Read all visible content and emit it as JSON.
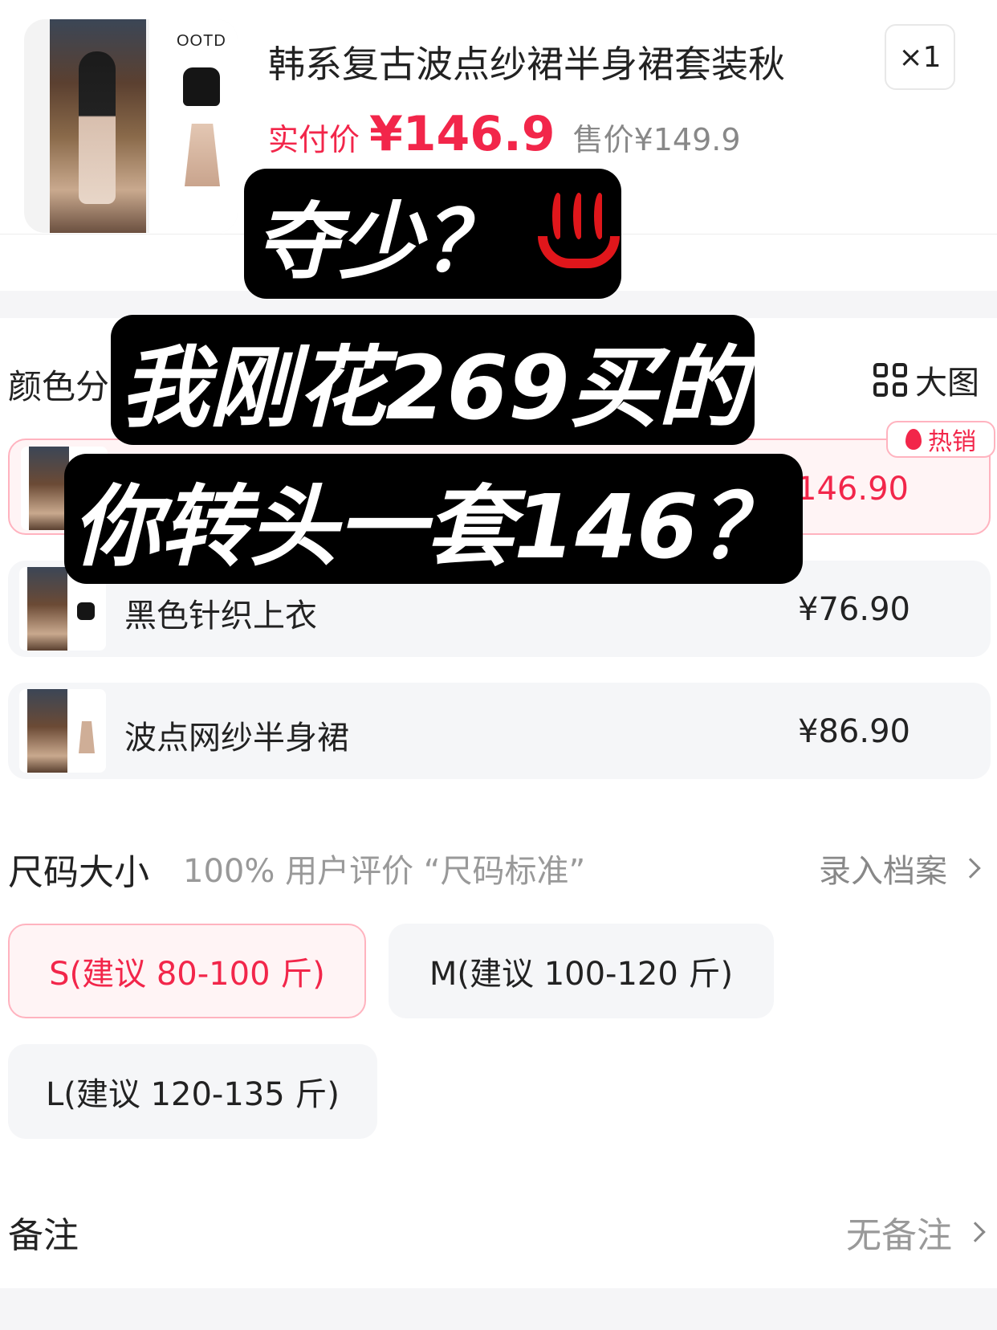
{
  "product": {
    "brand": "OOTD",
    "title": "韩系复古波点纱裙半身裙套装秋",
    "quantity": "×1",
    "paid_label": "实付价",
    "paid_value": "¥146.9",
    "sale_label": "售价¥149.9"
  },
  "color_section": {
    "title": "颜色分",
    "bigview_label": "大图",
    "hot_badge": "热销",
    "options": [
      {
        "label": "",
        "price": "¥146.90",
        "selected": true
      },
      {
        "label": "黑色针织上衣",
        "price": "¥76.90",
        "selected": false
      },
      {
        "label": "波点网纱半身裙",
        "price": "¥86.90",
        "selected": false
      }
    ]
  },
  "size_section": {
    "title": "尺码大小",
    "hint": "100% 用户评价 “尺码标准”",
    "archive_link": "录入档案",
    "options": [
      {
        "label": "S(建议 80-100 斤)",
        "selected": true
      },
      {
        "label": "M(建议 100-120 斤)",
        "selected": false
      },
      {
        "label": "L(建议 120-135 斤)",
        "selected": false
      }
    ]
  },
  "remark": {
    "title": "备注",
    "value": "无备注"
  },
  "captions": {
    "line1": "夺少？",
    "line2": "我刚花269买的",
    "line3": "你转头一套146？"
  },
  "colors": {
    "accent": "#f2264a",
    "selected_bg": "#fff4f5",
    "selected_border": "#ffb3bf",
    "caption_bg": "#000000",
    "hotspring_icon": "#e0161b"
  },
  "icons": [
    "grid-icon",
    "flame-icon",
    "chevron-right-icon",
    "hot-springs-icon"
  ]
}
